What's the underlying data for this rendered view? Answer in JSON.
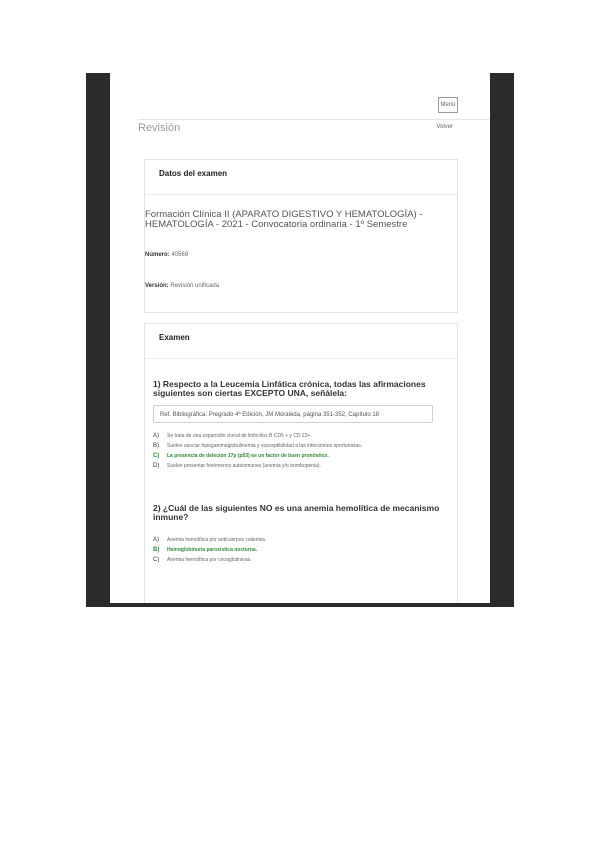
{
  "header": {
    "title": "Revisión",
    "menu_label": "Menú",
    "back_label": "Volver"
  },
  "exam_info": {
    "section_title": "Datos del examen",
    "exam_name": "Formación Clínica II (APARATO DIGESTIVO Y HEMATOLOGÍA) - HEMATOLOGÍA - 2021 - Convocatoria ordinaria - 1º Semestre",
    "number_label": "Número:",
    "number_value": "40569",
    "version_label": "Versión:",
    "version_value": "Revisión unificada"
  },
  "exam": {
    "section_title": "Examen",
    "questions": [
      {
        "text": "1) Respecto a la Leucemia Linfática crónica, todas las afirmaciones siguientes son ciertas EXCEPTO UNA, señálela:",
        "reference": "Ref. Bibliográfica: Pregrado 4ª Edición, JM Moraleda, página 351-352, Capítulo 18",
        "options": [
          {
            "letter": "A)",
            "text": "Se trata de una expansión clonal de linfocitos B CD5 + y CD 23+."
          },
          {
            "letter": "B)",
            "text": "Suelen asociar hipogammaglobulinemia y susceptibilidad a las infecciones oportunistas."
          },
          {
            "letter": "C)",
            "text": "La presencia de deleción 17p (p53) es un factor de buen pronóstico.",
            "correct": true
          },
          {
            "letter": "D)",
            "text": "Suelen presentar fenómenos autoinmunes (anemia y/o trombopenia)."
          }
        ]
      },
      {
        "text": "2) ¿Cuál de las siguientes NO es una anemia hemolítica de mecanismo inmune?",
        "options": [
          {
            "letter": "A)",
            "text": "Anemia hemolítica por anticuerpos calientes."
          },
          {
            "letter": "B)",
            "text": "Hemoglobinuria paroxística nocturna.",
            "correct": true
          },
          {
            "letter": "C)",
            "text": "Anemia hemolítica por crioaglutininas."
          }
        ]
      }
    ]
  }
}
